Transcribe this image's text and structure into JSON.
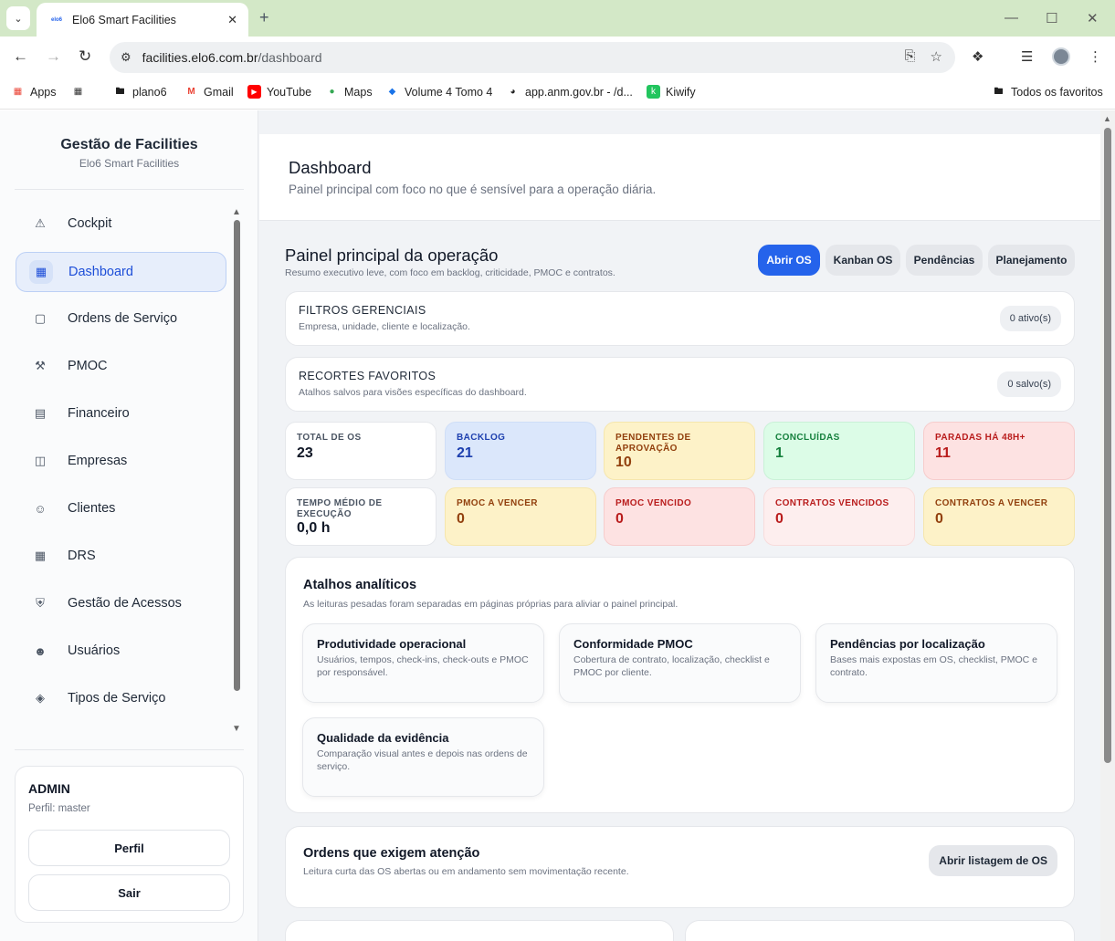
{
  "browser": {
    "tab_title": "Elo6 Smart Facilities",
    "favicon_text": "elo6",
    "url_host": "facilities.elo6.com.br",
    "url_path": "/dashboard",
    "bookmarks": [
      {
        "label": "Apps",
        "icon": "apps-grid-icon"
      },
      {
        "label": "plano6",
        "icon": "folder-icon"
      },
      {
        "label": "Gmail",
        "icon": "gmail-icon"
      },
      {
        "label": "YouTube",
        "icon": "youtube-icon"
      },
      {
        "label": "Maps",
        "icon": "maps-pin-icon"
      },
      {
        "label": "Volume 4 Tomo 4",
        "icon": "site-icon"
      },
      {
        "label": "app.anm.gov.br - /d...",
        "icon": "globe-icon"
      },
      {
        "label": "Kiwify",
        "icon": "kiwify-icon"
      }
    ],
    "all_bookmarks": "Todos os favoritos"
  },
  "sidebar": {
    "title": "Gestão de Facilities",
    "subtitle": "Elo6 Smart Facilities",
    "items": [
      {
        "label": "Cockpit",
        "icon": "warning-triangle-icon"
      },
      {
        "label": "Dashboard",
        "icon": "dashboard-grid-icon",
        "active": true
      },
      {
        "label": "Ordens de Serviço",
        "icon": "clipboard-icon"
      },
      {
        "label": "PMOC",
        "icon": "wrench-icon"
      },
      {
        "label": "Financeiro",
        "icon": "wallet-icon"
      },
      {
        "label": "Empresas",
        "icon": "building-icon"
      },
      {
        "label": "Clientes",
        "icon": "users-icon"
      },
      {
        "label": "DRS",
        "icon": "calendar-icon"
      },
      {
        "label": "Gestão de Acessos",
        "icon": "shield-icon"
      },
      {
        "label": "Usuários",
        "icon": "user-gear-icon"
      },
      {
        "label": "Tipos de Serviço",
        "icon": "tag-icon"
      }
    ],
    "user": {
      "name": "ADMIN",
      "role": "Perfil: master",
      "profile_button": "Perfil",
      "logout_button": "Sair"
    }
  },
  "header": {
    "title": "Dashboard",
    "subtitle": "Painel principal com foco no que é sensível para a operação diária."
  },
  "overview": {
    "title": "Painel principal da operação",
    "subtitle": "Resumo executivo leve, com foco em backlog, criticidade, PMOC e contratos.",
    "actions": [
      "Abrir OS",
      "Kanban OS",
      "Pendências",
      "Planejamento"
    ]
  },
  "filters": {
    "title": "FILTROS GERENCIAIS",
    "subtitle": "Empresa, unidade, cliente e localização.",
    "badge": "0 ativo(s)"
  },
  "favorites": {
    "title": "RECORTES FAVORITOS",
    "subtitle": "Atalhos salvos para visões específicas do dashboard.",
    "badge": "0 salvo(s)"
  },
  "kpis": [
    {
      "label": "TOTAL DE OS",
      "value": "23",
      "tone": "white"
    },
    {
      "label": "BACKLOG",
      "value": "21",
      "tone": "blue"
    },
    {
      "label": "PENDENTES DE APROVAÇÃO",
      "value": "10",
      "tone": "yellow"
    },
    {
      "label": "CONCLUÍDAS",
      "value": "1",
      "tone": "green"
    },
    {
      "label": "PARADAS HÁ 48H+",
      "value": "11",
      "tone": "red"
    },
    {
      "label": "TEMPO MÉDIO DE EXECUÇÃO",
      "value": "0,0 h",
      "tone": "white"
    },
    {
      "label": "PMOC A VENCER",
      "value": "0",
      "tone": "yellow"
    },
    {
      "label": "PMOC VENCIDO",
      "value": "0",
      "tone": "red"
    },
    {
      "label": "CONTRATOS VENCIDOS",
      "value": "0",
      "tone": "pink"
    },
    {
      "label": "CONTRATOS A VENCER",
      "value": "0",
      "tone": "yellow"
    }
  ],
  "shortcuts": {
    "title": "Atalhos analíticos",
    "subtitle": "As leituras pesadas foram separadas em páginas próprias para aliviar o painel principal.",
    "cards": [
      {
        "title": "Produtividade operacional",
        "desc": "Usuários, tempos, check-ins, check-outs e PMOC por responsável."
      },
      {
        "title": "Conformidade PMOC",
        "desc": "Cobertura de contrato, localização, checklist e PMOC por cliente."
      },
      {
        "title": "Pendências por localização",
        "desc": "Bases mais expostas em OS, checklist, PMOC e contrato."
      },
      {
        "title": "Qualidade da evidência",
        "desc": "Comparação visual antes e depois nas ordens de serviço."
      }
    ]
  },
  "attention": {
    "title": "Ordens que exigem atenção",
    "subtitle": "Leitura curta das OS abertas ou em andamento sem movimentação recente.",
    "button": "Abrir listagem de OS"
  }
}
